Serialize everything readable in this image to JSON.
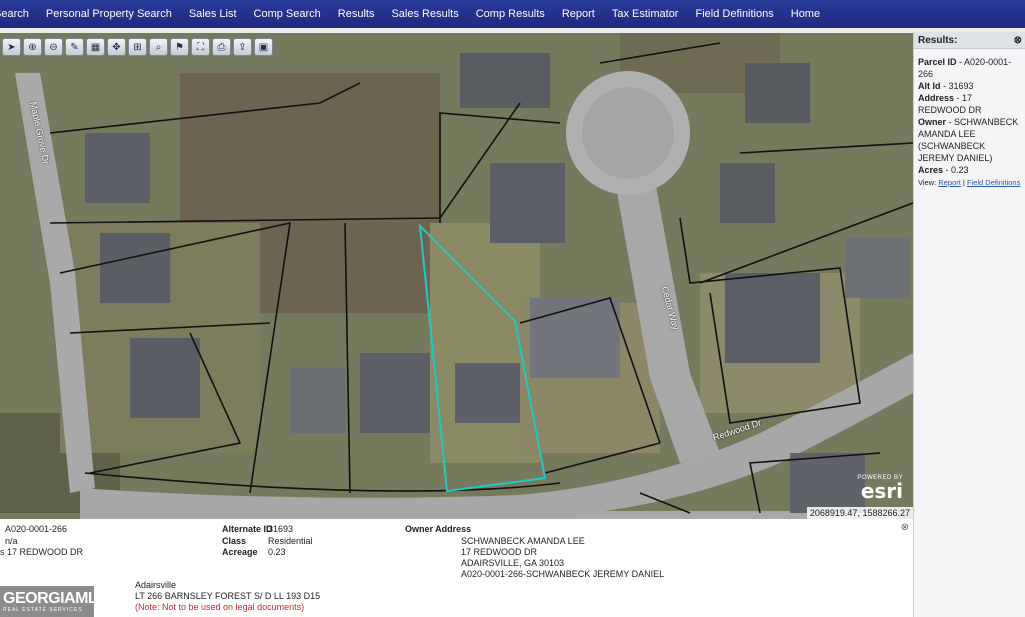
{
  "nav": {
    "items": [
      "Search",
      "Personal Property Search",
      "Sales List",
      "Comp Search",
      "Results",
      "Sales Results",
      "Comp Results",
      "Report",
      "Tax Estimator",
      "Field Definitions",
      "Home"
    ]
  },
  "toolbar": {
    "tools": [
      "cursor-icon",
      "zoom-in-icon",
      "zoom-out-icon",
      "pencil-icon",
      "map-icon",
      "pan-icon",
      "measure-icon",
      "magnifier-icon",
      "marker-icon",
      "extent-icon",
      "print-icon",
      "export-icon",
      "save-icon"
    ]
  },
  "map": {
    "road_labels": [
      "Maple Grove Dr",
      "Cedar Way",
      "Redwood Dr"
    ],
    "esri_powered": "POWERED BY",
    "esri_logo": "esri",
    "coordinates": "2068919.47, 1588266.27"
  },
  "results": {
    "title": "Results:",
    "parcel_id_label": "Parcel ID",
    "parcel_id": "- A020-0001-266",
    "alt_id_label": "Alt Id",
    "alt_id": "- 31693",
    "address_label": "Address",
    "address": "- 17 REDWOOD DR",
    "owner_label": "Owner",
    "owner": "- SCHWANBECK AMANDA LEE (SCHWANBECK JEREMY DANIEL)",
    "acres_label": "Acres",
    "acres": "- 0.23",
    "view_label": "View:",
    "report_link": "Report",
    "separator": "|",
    "field_defs_link": "Field Definitions"
  },
  "info": {
    "parcel_id": "A020-0001-266",
    "na": "n/a",
    "address_line": "s 17 REDWOOD DR",
    "alternate_id_label": "Alternate ID",
    "alternate_id": "31693",
    "class_label": "Class",
    "class_value": "Residential",
    "acreage_label": "Acreage",
    "acreage_value": "0.23",
    "owner_address_label": "Owner Address",
    "owner_name": "SCHWANBECK AMANDA LEE",
    "owner_street": "17 REDWOOD DR",
    "owner_city": "ADAIRSVILLE, GA 30103",
    "owner_extra": "A020-0001-266-SCHWANBECK JEREMY DANIEL",
    "city": "Adairsville",
    "legal": "LT 266 BARNSLEY FOREST S/ D LL 193 D15",
    "note": "(Note: Not to be used on legal documents)"
  },
  "watermark": {
    "title": "GEORGIAMLS",
    "subtitle": "REAL ESTATE SERVICES"
  },
  "colors": {
    "nav_bg": "#1d2a7f",
    "selected_parcel": "#22c7c7",
    "link": "#2d55b3",
    "note": "#c62828"
  }
}
